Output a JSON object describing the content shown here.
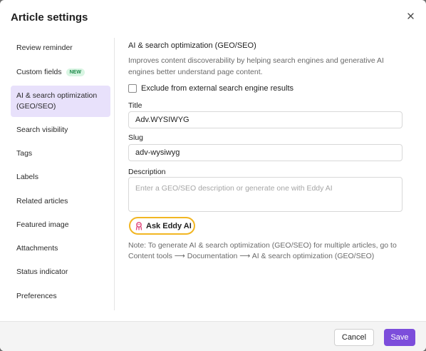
{
  "modal": {
    "title": "Article settings",
    "close_icon": "close-icon"
  },
  "sidebar": {
    "items": [
      {
        "label": "Review reminder",
        "active": false
      },
      {
        "label": "Custom fields",
        "badge": "NEW",
        "active": false
      },
      {
        "label": "AI & search optimization (GEO/SEO)",
        "active": true
      },
      {
        "label": "Search visibility",
        "active": false
      },
      {
        "label": "Tags",
        "active": false
      },
      {
        "label": "Labels",
        "active": false
      },
      {
        "label": "Related articles",
        "active": false
      },
      {
        "label": "Featured image",
        "active": false
      },
      {
        "label": "Attachments",
        "active": false
      },
      {
        "label": "Status indicator",
        "active": false
      },
      {
        "label": "Preferences",
        "active": false
      }
    ]
  },
  "content": {
    "section_title": "AI & search optimization (GEO/SEO)",
    "section_desc": "Improves content discoverability by helping search engines and generative AI engines better understand page content.",
    "exclude_label": "Exclude from external search engine results",
    "exclude_checked": false,
    "title_label": "Title",
    "title_value": "Adv.WYSIWYG",
    "slug_label": "Slug",
    "slug_value": "adv-wysiwyg",
    "description_label": "Description",
    "description_value": "",
    "description_placeholder": "Enter a GEO/SEO description or generate one with Eddy AI",
    "ask_button_label": "Ask Eddy AI",
    "ask_button_icon": "eddy-ai-icon",
    "note": "Note: To generate AI & search optimization (GEO/SEO) for multiple articles, go to Content tools ⟶ Documentation ⟶ AI & search optimization (GEO/SEO)"
  },
  "footer": {
    "cancel_label": "Cancel",
    "save_label": "Save"
  },
  "colors": {
    "accent": "#7c4ddb",
    "active_bg": "#e8e1fb",
    "ask_border": "#f2b622",
    "badge_bg": "#d9f5e3",
    "badge_text": "#1d8a4a"
  }
}
